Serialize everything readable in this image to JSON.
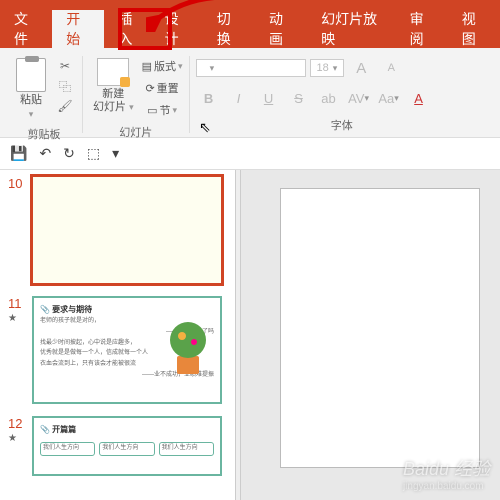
{
  "tabs": {
    "file": "文件",
    "home": "开始",
    "insert": "插入",
    "design": "设计",
    "transition": "切换",
    "animation": "动画",
    "slideshow": "幻灯片放映",
    "review": "审阅",
    "view": "视图"
  },
  "ribbon": {
    "clipboard": {
      "paste": "粘贴",
      "label": "剪贴板"
    },
    "slides": {
      "new_line1": "新建",
      "new_line2": "幻灯片",
      "layout": "版式",
      "reset": "重置",
      "section": "节",
      "label": "幻灯片"
    },
    "font": {
      "size": "18",
      "b": "B",
      "i": "I",
      "u": "U",
      "s": "S",
      "label": "字体",
      "grow": "A",
      "shrink": "A",
      "aa": "Aa"
    }
  },
  "qat": {
    "save": "💾",
    "undo": "↶",
    "redo": "↻",
    "start": "⬚"
  },
  "thumbs": {
    "s10": {
      "num": "10"
    },
    "s11": {
      "num": "11",
      "title": "📎 要求与期待",
      "lines": [
        "老师的孩子就是对的，",
        "——那你成功了吗",
        "找最少时间披起，心中说是应趣多，",
        "优秀就是是做每一个人，信成就每一个人",
        "衣血会流到上，只有该会才能被很流",
        "——业不成功，业绩难提振"
      ]
    },
    "s12": {
      "num": "12",
      "title": "📎 开篇篇",
      "card": "我们人生方向"
    }
  },
  "watermark": {
    "main": "Baidu 经验",
    "sub": "jingyan.baidu.com"
  }
}
